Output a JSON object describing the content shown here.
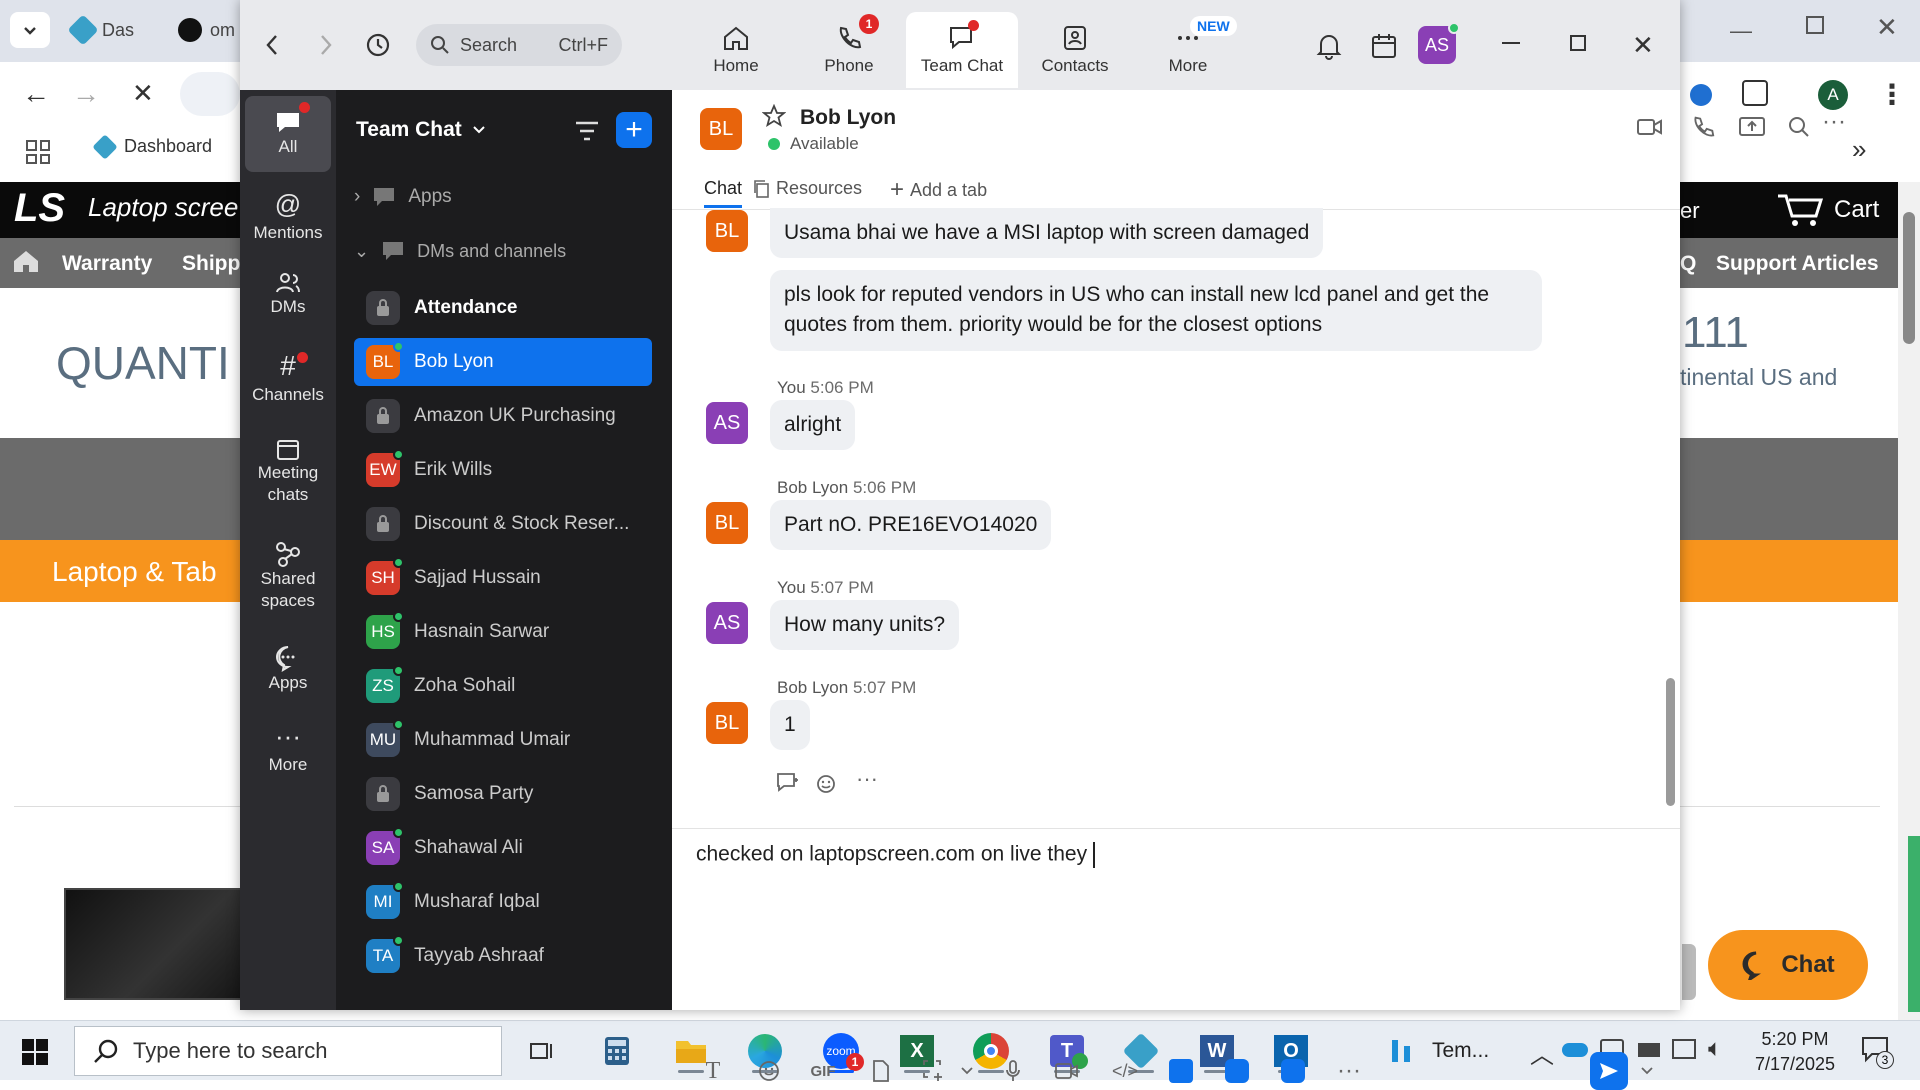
{
  "browser": {
    "tabs": [
      {
        "label": "Das"
      },
      {
        "label": "om"
      }
    ],
    "bookmark": "Dashboard",
    "avatar_letter": "A",
    "site": {
      "logo": "LS",
      "brand": "Laptop scree",
      "cart": "Cart",
      "header_right": "er",
      "nav": [
        "Warranty",
        "Shipp"
      ],
      "nav_right": [
        "Q",
        "Support Articles"
      ],
      "quantity_text": "QUANTI",
      "phone_partial": "111",
      "continental_text": "tinental US and",
      "banner_text": "Laptop & Tab",
      "chat_button": "Chat"
    }
  },
  "zoom": {
    "search": {
      "placeholder": "Search",
      "shortcut": "Ctrl+F"
    },
    "tabs": [
      {
        "label": "Home"
      },
      {
        "label": "Phone",
        "badge": "1"
      },
      {
        "label": "Team Chat"
      },
      {
        "label": "Contacts"
      },
      {
        "label": "More",
        "badge": "NEW"
      }
    ],
    "user_initials": "AS",
    "rail": [
      {
        "label": "All"
      },
      {
        "label": "Mentions"
      },
      {
        "label": "DMs"
      },
      {
        "label": "Channels"
      },
      {
        "label": "Meeting chats"
      },
      {
        "label": "Shared spaces"
      },
      {
        "label": "Apps"
      },
      {
        "label": "More"
      }
    ],
    "list": {
      "title": "Team Chat",
      "apps_label": "Apps",
      "section_label": "DMs and channels",
      "items": [
        {
          "label": "Attendance",
          "type": "lock",
          "bold": true
        },
        {
          "label": "Bob Lyon",
          "initials": "BL",
          "color": "#e8640c",
          "selected": true
        },
        {
          "label": "Amazon UK Purchasing",
          "type": "lock"
        },
        {
          "label": "Erik Wills",
          "initials": "EW",
          "color": "#d63b2b"
        },
        {
          "label": "Discount & Stock Reser...",
          "type": "lock"
        },
        {
          "label": "Sajjad Hussain",
          "initials": "SH",
          "color": "#d63b2b"
        },
        {
          "label": "Hasnain Sarwar",
          "initials": "HS",
          "color": "#2ea34a"
        },
        {
          "label": "Zoha Sohail",
          "initials": "ZS",
          "color": "#1f9b7a"
        },
        {
          "label": "Muhammad Umair",
          "initials": "MU",
          "color": "#3e4a5e"
        },
        {
          "label": "Samosa Party",
          "type": "lock"
        },
        {
          "label": "Shahawal Ali",
          "initials": "SA",
          "color": "#8a3fb5"
        },
        {
          "label": "Musharaf Iqbal",
          "initials": "MI",
          "color": "#1f7fc4"
        },
        {
          "label": "Tayyab Ashraaf",
          "initials": "TA",
          "color": "#1f7fc4"
        }
      ]
    },
    "chat": {
      "contact_initials": "BL",
      "contact_name": "Bob Lyon",
      "status": "Available",
      "subtabs": [
        "Chat",
        "Resources",
        "Add a tab"
      ],
      "messages": [
        {
          "text": "Usama bhai we have a MSI laptop with screen damaged"
        },
        {
          "text": "pls look for reputed vendors in US who can install new lcd panel and get the quotes from them. priority would be for the closest options"
        },
        {
          "sender": "You",
          "time": "5:06 PM",
          "initials": "AS",
          "text": "alright"
        },
        {
          "sender": "Bob Lyon",
          "time": "5:06 PM",
          "initials": "BL",
          "text": "Part nO. PRE16EVO14020"
        },
        {
          "sender": "You",
          "time": "5:07 PM",
          "initials": "AS",
          "text": "How many units?"
        },
        {
          "sender": "Bob Lyon",
          "time": "5:07 PM",
          "initials": "BL",
          "text": "1"
        }
      ],
      "composer_text": "checked on laptopscreen.com on live they "
    }
  },
  "taskbar": {
    "search_placeholder": "Type here to search",
    "teams_label": "Tem...",
    "time": "5:20 PM",
    "date": "7/17/2025",
    "notif_count": "3"
  },
  "colors": {
    "accent": "#0e72ed",
    "bl": "#e8640c",
    "as": "#8a3fb5"
  }
}
